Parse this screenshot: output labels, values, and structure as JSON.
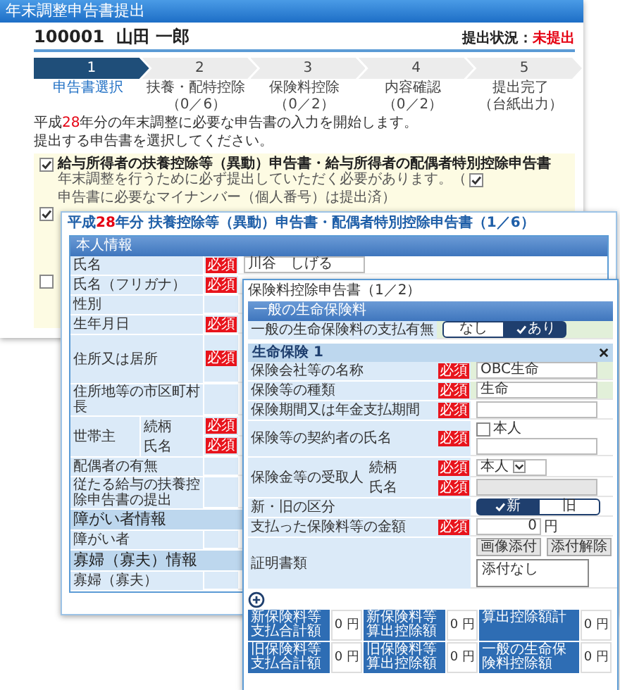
{
  "back_window": {
    "title": "年末調整申告書提出",
    "employee": "100001  山田 一郎",
    "status_label": "提出状況：",
    "status_value": "未提出",
    "steps": [
      {
        "number": "1",
        "label": "申告書選択",
        "selected": true
      },
      {
        "number": "2",
        "label": "扶養・配特控除",
        "count": "（0／6）",
        "selected": false
      },
      {
        "number": "3",
        "label": "保険料控除",
        "count": "（0／2）",
        "selected": false
      },
      {
        "number": "4",
        "label": "内容確認",
        "count": "（0／2）",
        "selected": false
      },
      {
        "number": "5",
        "label": "提出完了",
        "count": "（台紙出力）",
        "selected": false
      }
    ],
    "intro_lines": [
      {
        "parts": [
          {
            "text": "平成"
          },
          {
            "text": "28",
            "highlight": true
          },
          {
            "text": "年分の年末調整に必要な申告書の入力を開始します。"
          }
        ]
      },
      {
        "parts": [
          {
            "text": "提出する申告書を選択してください。"
          }
        ]
      }
    ],
    "forms": [
      {
        "checked": true,
        "title": "給与所得者の扶養控除等（異動）申告書・給与所得者の配偶者特別控除申告書",
        "note": "年末調整を行うために必ず提出していただく必要があります。（",
        "mynumber": {
          "checked": true,
          "text": "申告書に必要なマイナンバー（個人番号）は提出済）"
        }
      },
      {
        "checked": true
      },
      {
        "checked": false
      }
    ]
  },
  "middle_window": {
    "title_parts": [
      {
        "text": "平成"
      },
      {
        "text": "28",
        "highlight": true
      },
      {
        "text": "年分 扶養控除等（異動）申告書・配偶者特別控除申告書（1／6）"
      }
    ],
    "section_title": "本人情報",
    "rows": [
      {
        "kind": "field",
        "label": "氏名",
        "badge": "必須",
        "value": "川谷　しげる"
      },
      {
        "kind": "field",
        "label": "氏名（フリガナ）",
        "badge": "必須"
      },
      {
        "kind": "field",
        "label": "性別"
      },
      {
        "kind": "field",
        "label": "生年月日",
        "badge": "必須"
      },
      {
        "kind": "address",
        "label": "住所又は居所",
        "badge": "必須"
      },
      {
        "kind": "field",
        "label": "住所地等の市区町村長"
      },
      {
        "kind": "group",
        "label": "世帯主",
        "children": [
          {
            "label": "続柄",
            "badge": "必須"
          },
          {
            "label": "氏名",
            "badge": "必須"
          }
        ]
      },
      {
        "kind": "field",
        "label": "配偶者の有無"
      },
      {
        "kind": "field",
        "label": "従たる給与の扶養控除申告書の提出"
      },
      {
        "kind": "section",
        "label": "障がい者情報"
      },
      {
        "kind": "field",
        "label": "障がい者"
      },
      {
        "kind": "section",
        "label": "寡婦（寡夫）情報"
      },
      {
        "kind": "field",
        "label": "寡婦（寡夫）"
      }
    ]
  },
  "front_window": {
    "title": "保険料控除申告書（1／2）",
    "section_title": "一般の生命保険料",
    "payment": {
      "label": "一般の生命保険料の支払有無",
      "options": [
        {
          "label": "なし",
          "selected": false
        },
        {
          "label": "あり",
          "selected": true
        }
      ]
    },
    "policy": {
      "title": "生命保険 1",
      "rows": [
        {
          "kind": "input",
          "label": "保険会社等の名称",
          "badge": "必須",
          "value": "OBC生命",
          "highlighted": true
        },
        {
          "kind": "input",
          "label": "保険等の種類",
          "badge": "必須",
          "value": "生命",
          "highlighted": true
        },
        {
          "kind": "input",
          "label": "保険期間又は年金支払期間",
          "badge": "必須",
          "highlighted": false
        },
        {
          "kind": "checkbox_input",
          "label": "保険等の契約者の氏名",
          "badge": "必須",
          "checkbox": {
            "label": "本人",
            "checked": false
          },
          "highlighted": false
        },
        {
          "kind": "group",
          "label": "保険金等の受取人",
          "highlighted": false,
          "children": [
            {
              "kind": "select",
              "label": "続柄",
              "badge": "必須",
              "value": "本人",
              "disabled": false
            },
            {
              "kind": "input",
              "label": "氏名",
              "badge": "必須",
              "disabled": true
            }
          ]
        },
        {
          "kind": "toggle",
          "label": "新・旧の区分",
          "highlighted": false,
          "options": [
            {
              "label": "新",
              "selected": true
            },
            {
              "label": "旧",
              "selected": false
            }
          ]
        },
        {
          "kind": "amount",
          "label": "支払った保険料等の金額",
          "badge": "必須",
          "value": "0",
          "unit": "円",
          "highlighted": false
        },
        {
          "kind": "attachment",
          "label": "証明書類",
          "buttons": [
            "画像添付",
            "添付解除"
          ],
          "value": "添付なし",
          "highlighted": false
        }
      ]
    },
    "summary": [
      [
        {
          "label": "新保険料等支払合計額",
          "value": "0 円"
        },
        {
          "label": "新保険料等算出控除額",
          "value": "0 円"
        },
        {
          "label": "算出控除額計",
          "value": "0 円"
        }
      ],
      [
        {
          "label": "旧保険料等支払合計額",
          "value": "0 円"
        },
        {
          "label": "旧保険料等算出控除額",
          "value": "0 円"
        },
        {
          "label": "一般の生命保険料控除額",
          "value": "0 円"
        }
      ]
    ]
  }
}
